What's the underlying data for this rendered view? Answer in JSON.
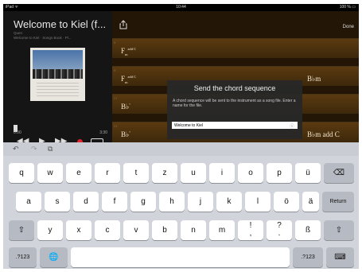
{
  "status": {
    "left": "iPad ᯤ",
    "time": "10:44",
    "right": "100 % ▭"
  },
  "player": {
    "title": "Welcome to Kiel (f...",
    "subtitle1": "Quen",
    "subtitle2": "Welcome to Kiel · Songs Book · Pl...",
    "album_text": "WELCOME TO KIEL",
    "time_start": "0:00",
    "time_end": "3:30",
    "rewind": "◀◀",
    "play": "▶",
    "forward": "▶▶"
  },
  "chords": {
    "share_icon": "share-icon",
    "done": "Done",
    "rows": [
      {
        "bar": "5",
        "root": "F",
        "sub": "m",
        "sup": "add C",
        "right": ""
      },
      {
        "bar": "9",
        "root": "F",
        "sub": "m",
        "sup": "add C",
        "right": "B♭m"
      },
      {
        "bar": "17",
        "root": "B♭",
        "sub": "",
        "sup": "°",
        "right": ""
      },
      {
        "bar": "21",
        "root": "B♭",
        "sub": "",
        "sup": "°",
        "right": "B♭m add C"
      }
    ]
  },
  "dialog": {
    "title": "Send the chord sequence",
    "message": "A chord sequence will be sent to the instrument as a song file. Enter a name for the file.",
    "input_value": "Welcome to Kiel",
    "clear_icon": "ⓧ"
  },
  "keyboard": {
    "undo": "↶",
    "redo": "↷",
    "paste": "⧉",
    "row1": [
      "q",
      "w",
      "e",
      "r",
      "t",
      "z",
      "u",
      "i",
      "o",
      "p",
      "ü"
    ],
    "backspace": "⌫",
    "row2": [
      "a",
      "s",
      "d",
      "f",
      "g",
      "h",
      "j",
      "k",
      "l",
      "ö",
      "ä"
    ],
    "return": "Return",
    "shift": "⇧",
    "row3": [
      "y",
      "x",
      "c",
      "v",
      "b",
      "n",
      "m",
      "!\n,",
      "?\n.",
      "ß"
    ],
    "numbers": ".?123",
    "globe": "🌐",
    "hide": "⌨"
  }
}
